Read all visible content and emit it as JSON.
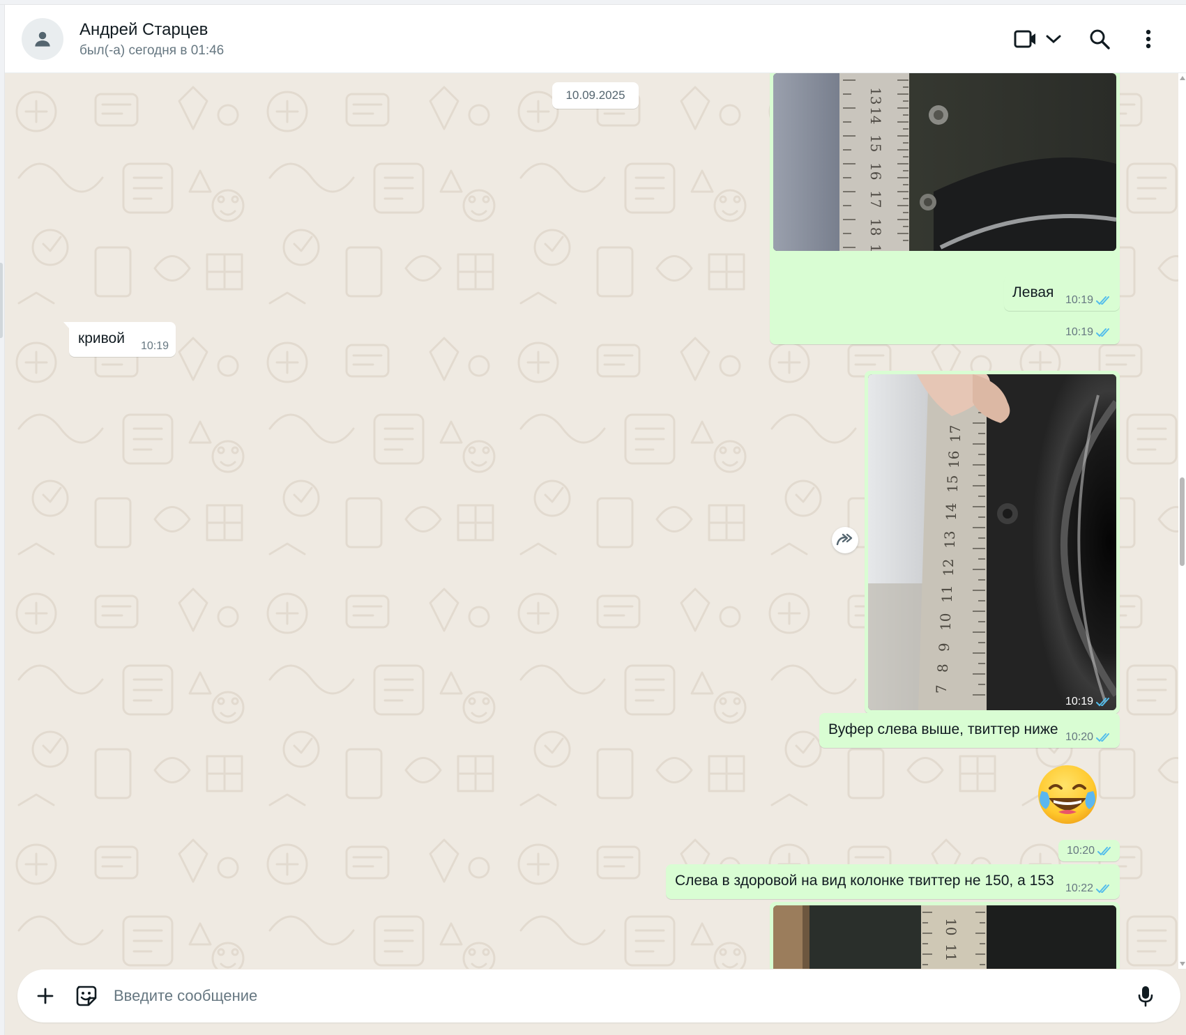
{
  "header": {
    "contact_name": "Андрей Старцев",
    "contact_status": "был(-а) сегодня в 01:46",
    "icons": [
      "person-icon",
      "video-call-icon",
      "chevron-down-icon",
      "search-icon",
      "more-vert-icon"
    ]
  },
  "chat": {
    "date_divider": "10.09.2025",
    "messages": [
      {
        "dir": "out",
        "type": "photo",
        "time": "10:19",
        "status": "read"
      },
      {
        "dir": "out",
        "type": "text",
        "text": "Левая",
        "time": "10:19",
        "status": "read"
      },
      {
        "dir": "in",
        "type": "text",
        "text": "кривой",
        "time": "10:19"
      },
      {
        "dir": "out",
        "type": "photo",
        "time": "10:19",
        "status": "read"
      },
      {
        "dir": "out",
        "type": "text",
        "text": "Вуфер слева выше, твиттер ниже",
        "time": "10:20",
        "status": "read"
      },
      {
        "dir": "out",
        "type": "emoji",
        "emoji": "face-with-tears-of-joy",
        "time": "10:20",
        "status": "read"
      },
      {
        "dir": "out",
        "type": "text",
        "text": "Слева в здоровой на вид колонке твиттер не 150, а 153",
        "time": "10:22",
        "status": "read"
      },
      {
        "dir": "out",
        "type": "photo",
        "time": "",
        "status": ""
      }
    ]
  },
  "composer": {
    "placeholder": "Введите сообщение",
    "icons": [
      "plus-icon",
      "sticker-icon",
      "microphone-icon"
    ]
  },
  "colors": {
    "outgoing_bubble": "#d9fdd3",
    "incoming_bubble": "#ffffff",
    "chat_background": "#efeae2",
    "read_tick": "#53bdeb"
  }
}
